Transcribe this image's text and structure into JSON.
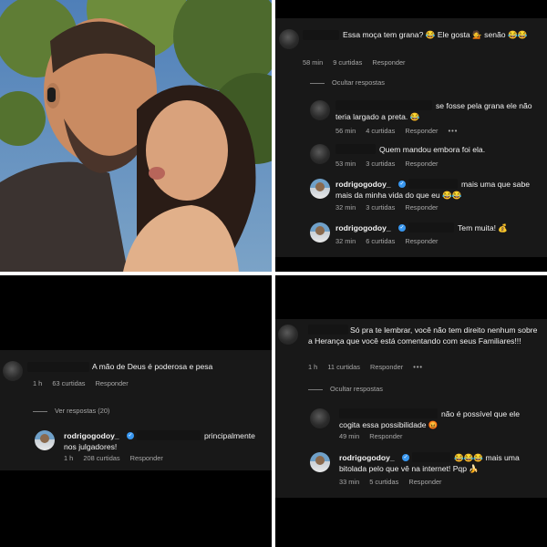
{
  "panel_tr": {
    "c1": {
      "text": "Essa moça tem grana? 😂 Ele gosta 💁 senão 😂😂",
      "time": "58 min",
      "likes": "9 curtidas",
      "reply": "Responder"
    },
    "hidden_replies": "Ocultar respostas",
    "c2": {
      "text": "se fosse pela grana ele não teria largado a preta. 😂",
      "time": "56 min",
      "likes": "4 curtidas",
      "reply": "Responder"
    },
    "c3": {
      "text": "Quem mandou embora foi ela.",
      "time": "53 min",
      "likes": "3 curtidas",
      "reply": "Responder"
    },
    "c4": {
      "user": "rodrigogodoy_",
      "text": "mais uma que sabe mais da minha vida do que eu 😂😂",
      "time": "32 min",
      "likes": "3 curtidas",
      "reply": "Responder"
    },
    "c5": {
      "user": "rodrigogodoy_",
      "text": "Tem muita! 💰",
      "time": "32 min",
      "likes": "6 curtidas",
      "reply": "Responder"
    }
  },
  "panel_bl": {
    "c1": {
      "text": "A mão de Deus é poderosa e pesa",
      "time": "1 h",
      "likes": "63 curtidas",
      "reply": "Responder"
    },
    "view_replies": "Ver respostas (20)",
    "c2": {
      "user": "rodrigogodoy_",
      "text": "principalmente nos julgadores!",
      "time": "1 h",
      "likes": "208 curtidas",
      "reply": "Responder"
    }
  },
  "panel_br": {
    "c1": {
      "text": "Só pra te lembrar, você não tem direito nenhum sobre a Herança que você está comentando com seus Familiares!!!",
      "time": "1 h",
      "likes": "11 curtidas",
      "reply": "Responder"
    },
    "hidden_replies": "Ocultar respostas",
    "c2": {
      "text": "não é possível que ele cogita essa possibilidade 😡",
      "time": "49 min",
      "likes": "",
      "reply": "Responder"
    },
    "c3": {
      "user": "rodrigogodoy_",
      "text": "😂😂😂 mais uma bitolada pelo que vê na internet! Pqp 🍌",
      "time": "33 min",
      "likes": "5 curtidas",
      "reply": "Responder"
    }
  },
  "colors": {
    "card_bg": "#181818",
    "text": "#f2f2f2",
    "meta": "#a8a8a8",
    "verified": "#3897f0"
  }
}
